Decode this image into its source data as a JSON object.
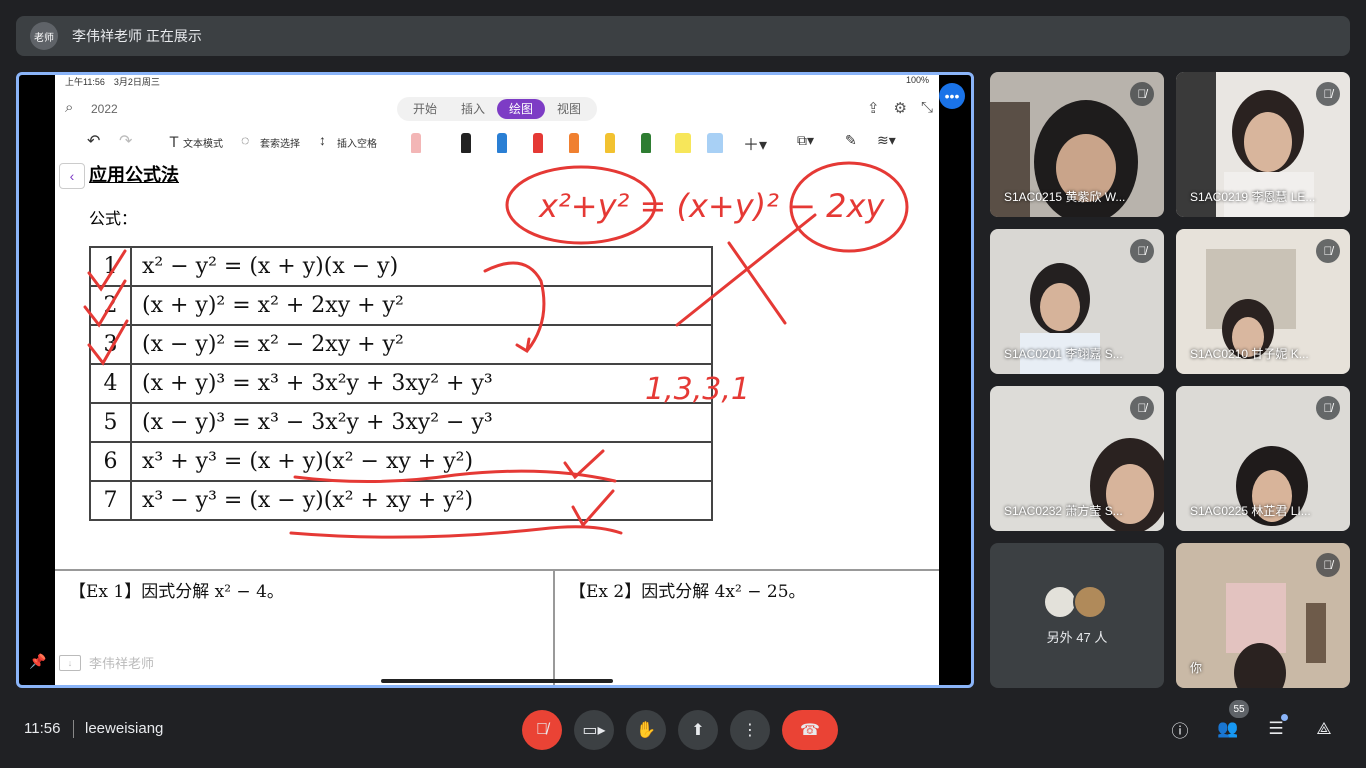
{
  "topbar": {
    "avatar_text": "老师",
    "presenting_text": "李伟祥老师 正在展示"
  },
  "screen": {
    "status_time": "上午11:56　3月2日周三",
    "status_battery": "100%",
    "search_text": "2022",
    "tabs": [
      "开始",
      "插入",
      "绘图",
      "视图"
    ],
    "active_tab": "绘图",
    "tools": {
      "text_mode": "文本模式",
      "lasso": "套索选择",
      "insert_space": "插入空格"
    },
    "title": "应用公式法",
    "formula_label": "公式：",
    "formulas": [
      {
        "n": "1",
        "f": "x² − y² = (x + y)(x − y)"
      },
      {
        "n": "2",
        "f": "(x + y)² = x² + 2xy + y²"
      },
      {
        "n": "3",
        "f": "(x − y)² = x² − 2xy + y²"
      },
      {
        "n": "4",
        "f": "(x + y)³ = x³ + 3x²y + 3xy² + y³"
      },
      {
        "n": "5",
        "f": "(x − y)³ = x³ − 3x²y + 3xy² − y³"
      },
      {
        "n": "6",
        "f": "x³ + y³ = (x + y)(x² − xy + y²)"
      },
      {
        "n": "7",
        "f": "x³ − y³ = (x − y)(x² + xy + y²)"
      }
    ],
    "ex1": "【Ex 1】因式分解 x² − 4。",
    "ex2": "【Ex 2】因式分解 4x² − 25。",
    "handwriting_coeffs": "1,3,3,1",
    "handwriting_eq": "x²+y² = (x+y)² − 2xy",
    "presenter_chip": "李伟祥老师"
  },
  "participants": [
    {
      "name": "S1AC0215 黄紫欣 W...",
      "muted": true
    },
    {
      "name": "S1AC0219 李恩慧 LE...",
      "muted": true
    },
    {
      "name": "S1AC0201 李翊嘉 S...",
      "muted": true
    },
    {
      "name": "S1AC0210 甘子妮 K...",
      "muted": true
    },
    {
      "name": "S1AC0232 萧方莹 S...",
      "muted": true
    },
    {
      "name": "S1AC0225 林芷君 LI...",
      "muted": true
    }
  ],
  "more_people": "另外 47 人",
  "self_tile": {
    "name": "你"
  },
  "bottom": {
    "time": "11:56",
    "meeting_code": "leeweisiang",
    "people_count": "55"
  },
  "colors": {
    "accent_blue": "#8ab4f8",
    "end_red": "#ea4335",
    "tab_purple": "#7d3cc5",
    "ink_red": "#e53935"
  }
}
